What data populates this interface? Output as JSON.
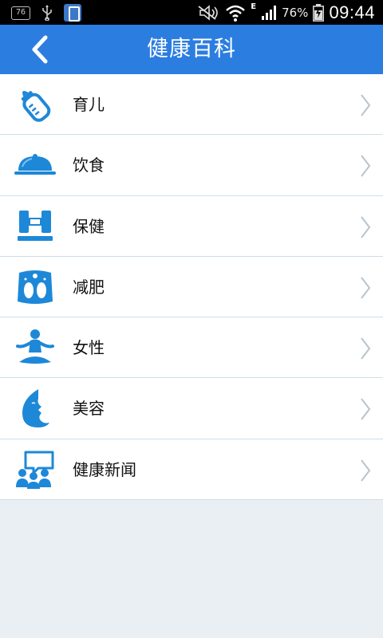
{
  "status_bar": {
    "notification_badge": "76",
    "battery_percent": "76%",
    "time": "09:44",
    "network_type": "E"
  },
  "app_bar": {
    "title": "健康百科",
    "back_icon": "chevron-left-icon"
  },
  "colors": {
    "accent": "#2b7de0",
    "icon_blue": "#1e88d8",
    "background": "#e9eff3",
    "divider": "#cfdde8"
  },
  "categories": [
    {
      "label": "育儿",
      "icon": "baby-bottle-icon"
    },
    {
      "label": "饮食",
      "icon": "food-cloche-icon"
    },
    {
      "label": "保健",
      "icon": "dumbbell-icon"
    },
    {
      "label": "减肥",
      "icon": "scale-icon"
    },
    {
      "label": "女性",
      "icon": "yoga-woman-icon"
    },
    {
      "label": "美容",
      "icon": "face-profile-icon"
    },
    {
      "label": "健康新闻",
      "icon": "news-chat-icon"
    }
  ]
}
